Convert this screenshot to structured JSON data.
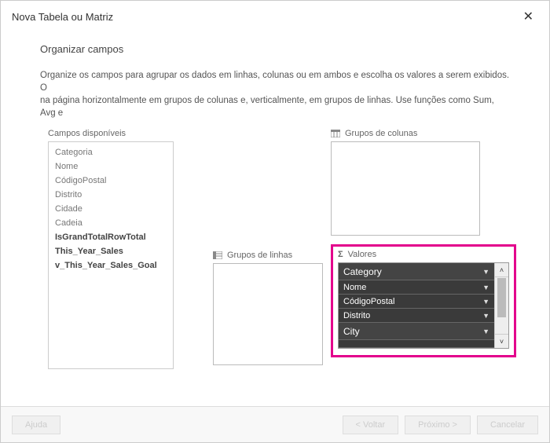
{
  "title": "Nova Tabela ou Matriz",
  "section_heading": "Organizar campos",
  "description": "Organize os campos para agrupar os dados em linhas, colunas ou em ambos e escolha os valores a serem exibidos. O\nna página horizontalmente em grupos de colunas e, verticalmente, em grupos de linhas. Use funções como Sum, Avg e",
  "available": {
    "label": "Campos disponíveis",
    "items": [
      "Categoria",
      "Nome",
      "CódigoPostal",
      "Distrito",
      "Cidade",
      "Cadeia",
      "IsGrandTotalRowTotal",
      "This_Year_Sales",
      "v_This_Year_Sales_Goal"
    ]
  },
  "column_groups": {
    "label": "Grupos de colunas"
  },
  "row_groups": {
    "label": "Grupos de linhas"
  },
  "values": {
    "label": "Valores",
    "items": [
      "Category",
      "Nome",
      "CódigoPostal",
      "Distrito",
      "City"
    ]
  },
  "buttons": {
    "help": "Ajuda",
    "back": "< Voltar",
    "next": "Próximo >",
    "cancel": "Cancelar"
  }
}
